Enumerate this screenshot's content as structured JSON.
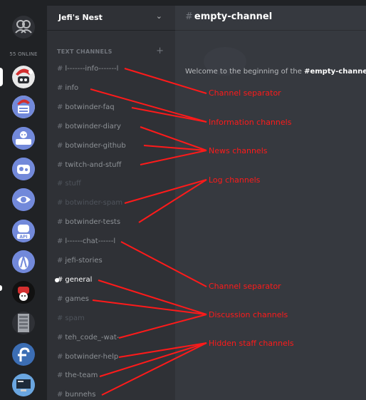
{
  "guild_rail": {
    "online_count": "55 ONLINE"
  },
  "server": {
    "name": "Jefi's Nest",
    "dropdown_icon": "chevron-down-icon"
  },
  "category": {
    "name": "TEXT CHANNELS",
    "add_icon": "plus-icon"
  },
  "channels": [
    {
      "name": "l-------info-------l",
      "state": "normal"
    },
    {
      "name": "info",
      "state": "normal"
    },
    {
      "name": "botwinder-faq",
      "state": "normal"
    },
    {
      "name": "botwinder-diary",
      "state": "normal"
    },
    {
      "name": "botwinder-github",
      "state": "normal"
    },
    {
      "name": "twitch-and-stuff",
      "state": "normal"
    },
    {
      "name": "stuff",
      "state": "muted"
    },
    {
      "name": "botwinder-spam",
      "state": "muted"
    },
    {
      "name": "botwinder-tests",
      "state": "normal"
    },
    {
      "name": "l------chat------l",
      "state": "normal"
    },
    {
      "name": "jefi-stories",
      "state": "normal"
    },
    {
      "name": "general",
      "state": "active"
    },
    {
      "name": "games",
      "state": "normal"
    },
    {
      "name": "spam",
      "state": "muted"
    },
    {
      "name": "teh_code_-wat-",
      "state": "normal"
    },
    {
      "name": "botwinder-help",
      "state": "normal"
    },
    {
      "name": "the-team",
      "state": "normal"
    },
    {
      "name": "bunnehs",
      "state": "normal"
    }
  ],
  "main": {
    "hash": "#",
    "channel_title": "empty-channel",
    "welcome_prefix": "Welcome to the beginning of the ",
    "welcome_channel": "#empty-channel"
  },
  "annotations": {
    "separator_1": "Channel separator",
    "information": "Information channels",
    "news": "News channels",
    "log": "Log channels",
    "separator_2": "Channel separator",
    "discussion": "Discussion channels",
    "hidden_staff": "Hidden staff channels"
  },
  "colors": {
    "annotation": "#ff1a1a",
    "blurple": "#7289da",
    "rail_bg": "#202225",
    "sidebar_bg": "#2f3136",
    "main_bg": "#36393f"
  }
}
